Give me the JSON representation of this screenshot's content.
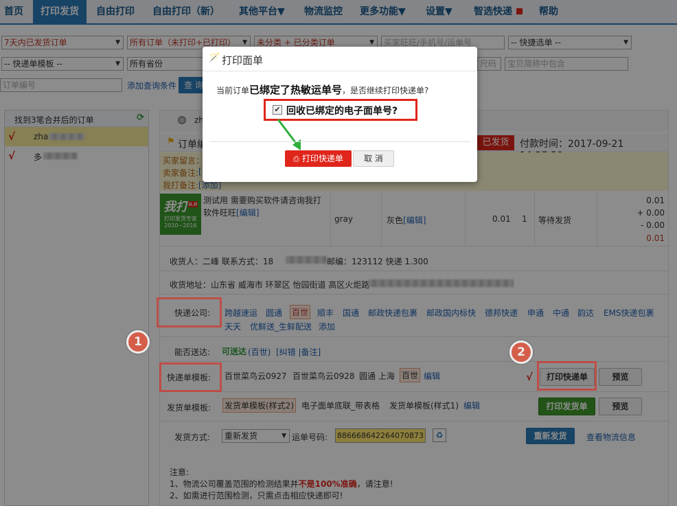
{
  "nav": {
    "items": [
      "首页",
      "打印发货",
      "自由打印",
      "自由打印（新）",
      "其他平台▼",
      "物流监控",
      "更多功能▼",
      "设置▼",
      "智选快递",
      "帮助"
    ]
  },
  "filters": {
    "order_time": "7天内已发货订单",
    "order_status": "所有订单（未打印+已打印）",
    "category": "未分类 + 已分类订单",
    "buyer_placeholder": "买家旺旺/手机号/运单号",
    "quick_select": "-- 快捷选单 --",
    "template_select": "-- 快递单模板 --",
    "province": "所有省份",
    "size_placeholder": "尺码",
    "item_placeholder": "宝贝简称中包含",
    "order_no_placeholder": "订单编号",
    "add_condition": "添加查询条件",
    "query_btn": "查 询"
  },
  "left_panel": {
    "header": "找到3笔合并后的订单",
    "rows": [
      {
        "check": "√",
        "name": "zha"
      },
      {
        "check": "√",
        "name": "多"
      }
    ]
  },
  "order": {
    "top_name": "zh",
    "header_prefix": "订单编",
    "status_badge": "已发货",
    "pay_time": "付款时间：2017-09-21 14:27:50",
    "buyer_msg": "买家留言：",
    "buyer_note_label": "卖家备注:",
    "buyer_note_link": "[",
    "my_note_label": "我打备注:",
    "my_note_link": "[添加]",
    "logo_text": "我打",
    "logo_version": "6.0",
    "logo_sub": "打印发货专家",
    "logo_years": "2010~2016",
    "product_desc": "测试用 需要购买软件请咨询我打软件旺旺",
    "product_edit": "[编辑]",
    "spec": "gray",
    "color": "灰色",
    "color_edit": "[编辑]",
    "price": "0.01",
    "qty": "1",
    "ship_status": "等待发货",
    "totals": [
      "0.01",
      "+ 0.00",
      "- 0.00",
      "0.01"
    ],
    "receiver": "收货人：二峰 联系方式：18",
    "receiver_tail": "邮编：123112 快递 1.300",
    "address": "收货地址：山东省 威海市 环翠区 怡园街道 高区火炬路",
    "carrier_label": "快递公司:",
    "carriers_row1": [
      "跨越速运",
      "圆通",
      "百世",
      "顺丰",
      "国通",
      "邮政快递包裹",
      "邮政国内标快",
      "德邦快递",
      "申通",
      "中通",
      "韵达",
      "EMS快递包裹"
    ],
    "carriers_row2": [
      "天天",
      "优鲜送_生鲜配送",
      "添加"
    ],
    "reachable_label": "能否送达:",
    "reachable_value": "可送达",
    "reachable_carrier": "(百世)",
    "reachable_links": "[纠错 |备注]",
    "template_label": "快递单模板:",
    "templates": [
      "百世菜鸟云0927",
      "百世菜鸟云0928",
      "圆通 上海",
      "百世"
    ],
    "template_edit": "编辑",
    "print_express_btn": "打印快递单",
    "preview_btn": "预览",
    "check_mark": "√",
    "invoice_label": "发货单模板:",
    "invoices": [
      "发货单模板(样式2)",
      "电子面单底联_带表格",
      "发货单模板(样式1)"
    ],
    "invoice_edit": "编辑",
    "print_invoice_btn": "打印发货单",
    "preview_btn2": "预览",
    "ship_method_label": "发货方式:",
    "ship_method": "重新发货",
    "waybill_label": "运单号码:",
    "waybill_no": "886668642264070873",
    "reship_btn": "重新发货",
    "track_link": "查看物流信息",
    "notice_title": "注意:",
    "notice1_a": "1、物流公司覆盖范围的检测结果并",
    "notice1_b": "不是100%准确",
    "notice1_c": "，请注意!",
    "notice2": "2、如需进行范围检测，只需点击相应快递即可!"
  },
  "annotations": {
    "circle1": "1",
    "circle2": "2"
  },
  "dialog": {
    "title": "打印面单",
    "msg_prefix": "当前订单",
    "msg_bold": "已绑定了热敏运单号",
    "msg_suffix": "，是否继续打印快递单?",
    "checkbox_label": "回收已绑定的电子面单号?",
    "print_btn": "打印快递单",
    "cancel_btn": "取 消"
  }
}
